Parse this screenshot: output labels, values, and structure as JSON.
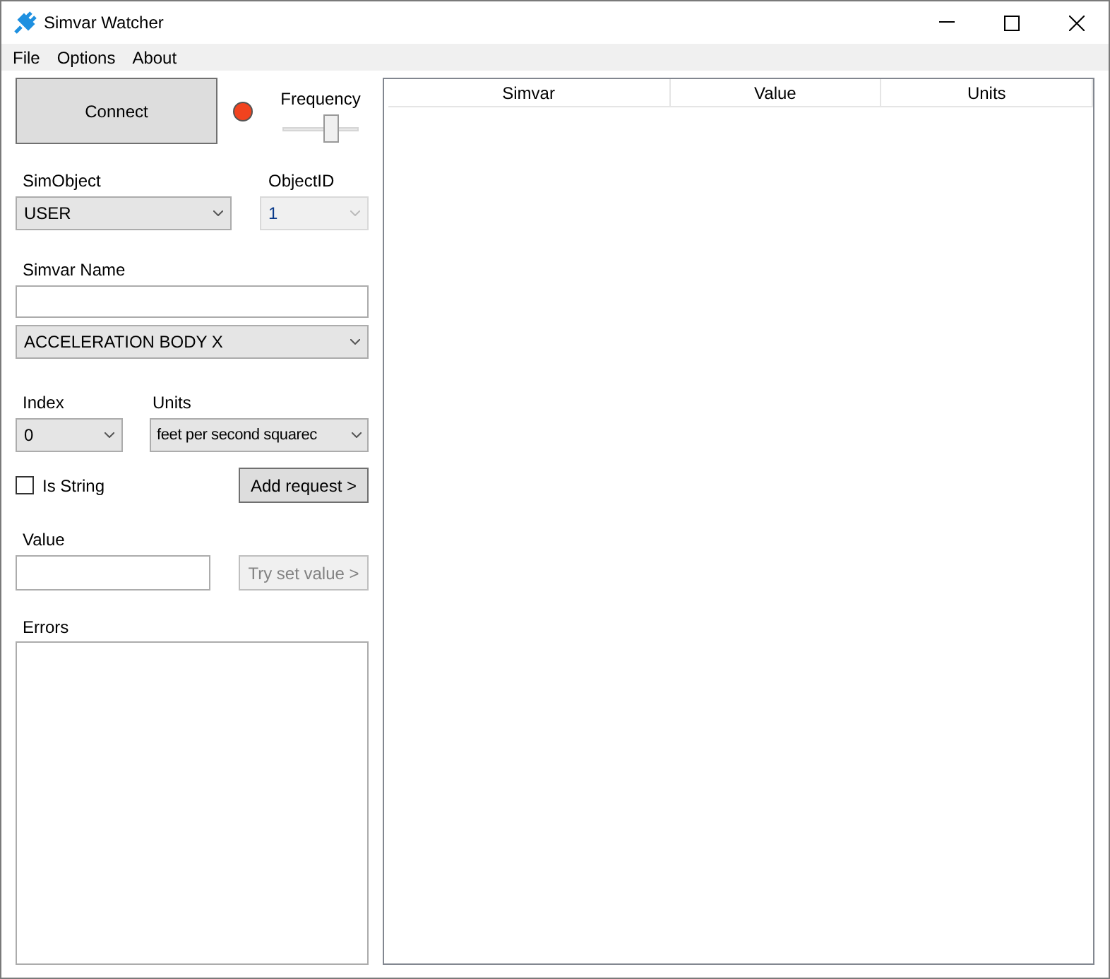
{
  "window": {
    "title": "Simvar Watcher"
  },
  "menu": [
    "File",
    "Options",
    "About"
  ],
  "connect_button": "Connect",
  "connection": {
    "connected": false
  },
  "frequency": {
    "label": "Frequency",
    "level": 0.68
  },
  "sim_object": {
    "label": "SimObject",
    "value": "USER"
  },
  "object_id": {
    "label": "ObjectID",
    "value": "1",
    "disabled": true
  },
  "simvar_name": {
    "label": "Simvar Name",
    "selection": "ACCELERATION BODY X"
  },
  "index": {
    "label": "Index",
    "value": "0"
  },
  "units": {
    "label": "Units",
    "value": "feet per second squarec"
  },
  "is_string": {
    "label": "Is String",
    "checked": false
  },
  "add_request_button": {
    "label": "Add request >",
    "disabled": false
  },
  "value": {
    "label": "Value"
  },
  "try_set_value_button": {
    "label": "Try set value >",
    "disabled": true
  },
  "errors": {
    "label": "Errors"
  },
  "table": {
    "columns": [
      "Simvar",
      "Value",
      "Units"
    ]
  }
}
